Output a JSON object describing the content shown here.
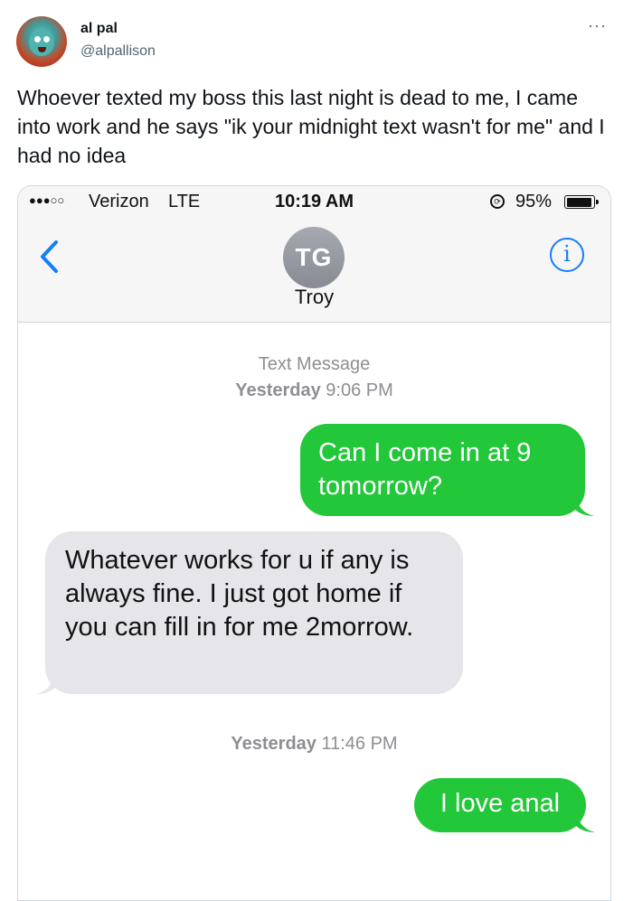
{
  "tweet": {
    "author_name": "al pal",
    "author_handle": "@alpallison",
    "more_icon": "ellipsis-icon",
    "more_glyph": "···",
    "text": "Whoever texted my boss this last night is dead to me, I came into work and he says \"ik your midnight text wasn't for me\" and I had no idea"
  },
  "phone": {
    "status_bar": {
      "signal_glyphs": "●●●○○",
      "carrier": "Verizon",
      "network": "LTE",
      "time": "10:19 AM",
      "battery_percent": "95%",
      "battery_level": 0.95
    },
    "header": {
      "contact_initials": "TG",
      "contact_name": "Troy",
      "info_glyph": "i"
    },
    "conversation": {
      "label_1": "Text Message",
      "day_1": "Yesterday",
      "time_1": "9:06 PM",
      "day_2": "Yesterday",
      "time_2": "11:46 PM",
      "messages": [
        {
          "direction": "sent",
          "text": "Can I come in at 9 tomorrow?"
        },
        {
          "direction": "received",
          "text": "Whatever works for u if any is always fine. I just got home if you can fill in for me 2morrow."
        },
        {
          "direction": "sent",
          "text": "I love anal"
        }
      ]
    },
    "colors": {
      "sent_bubble": "#23c73a",
      "received_bubble": "#e5e5ea",
      "ios_blue": "#147efb"
    }
  }
}
